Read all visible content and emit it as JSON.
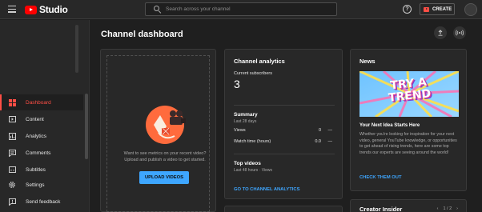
{
  "app": {
    "logo_text": "Studio"
  },
  "search": {
    "placeholder": "Search across your channel"
  },
  "header": {
    "create_label": "CREATE",
    "help_icon": "help-circle-icon"
  },
  "sidebar": {
    "items": [
      {
        "label": "Dashboard",
        "icon": "dashboard-icon",
        "active": true
      },
      {
        "label": "Content",
        "icon": "content-icon"
      },
      {
        "label": "Analytics",
        "icon": "analytics-icon"
      },
      {
        "label": "Comments",
        "icon": "comments-icon"
      },
      {
        "label": "Subtitles",
        "icon": "subtitles-icon"
      },
      {
        "label": "Settings",
        "icon": "gear-icon"
      },
      {
        "label": "Send feedback",
        "icon": "feedback-icon"
      }
    ]
  },
  "main": {
    "title": "Channel dashboard",
    "upload_card": {
      "text": "Want to see metrics on your recent video? Upload and publish a video to get started.",
      "button": "UPLOAD VIDEOS"
    },
    "analytics": {
      "title": "Channel analytics",
      "subscribers_label": "Current subscribers",
      "subscribers_value": "3",
      "summary_title": "Summary",
      "summary_period": "Last 28 days",
      "rows": [
        {
          "label": "Views",
          "value": "0",
          "change": "—"
        },
        {
          "label": "Watch time (hours)",
          "value": "0.0",
          "change": "—"
        }
      ],
      "top_videos_title": "Top videos",
      "top_videos_sub": "Last 48 hours · Views",
      "link": "GO TO CHANNEL ANALYTICS"
    },
    "news": {
      "title": "News",
      "image_text_line1": "TRY A",
      "image_text_line2": "TREND",
      "headline": "Your Next Idea Starts Here",
      "body": "Whether you're looking for inspiration for your next video, general YouTube knowledge, or opportunities to get ahead of rising trends, here are some top trends our experts are seeing around the world!",
      "link": "CHECK THEM OUT"
    },
    "insider": {
      "title": "Creator Insider",
      "pager": "1 / 2"
    }
  },
  "colors": {
    "accent": "#ff4e45",
    "link": "#3ea6ff",
    "background": "#1f1f1f",
    "surface": "#282828"
  }
}
